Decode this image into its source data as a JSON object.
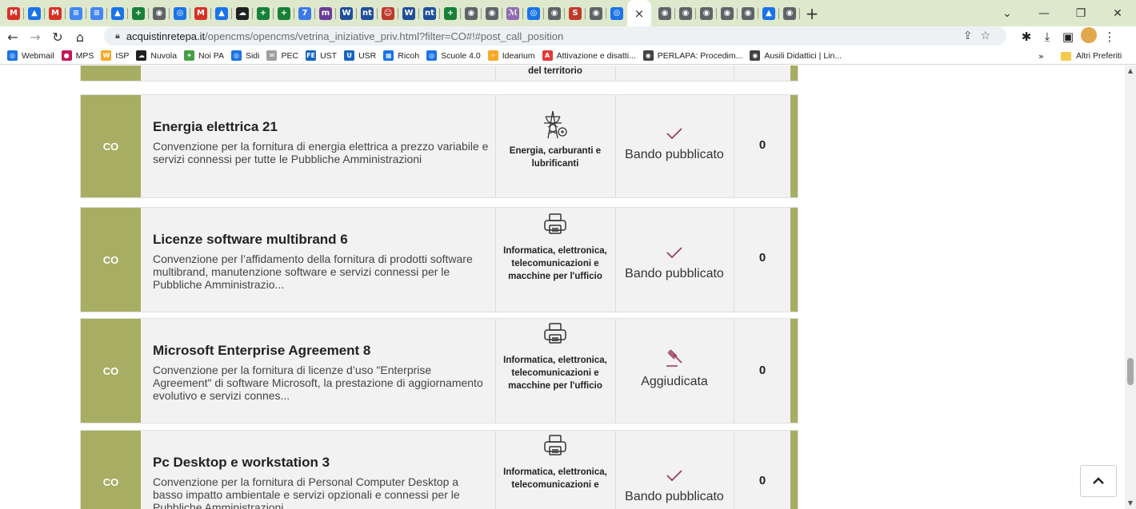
{
  "browser": {
    "close_tab_glyph": "×",
    "new_tab_glyph": "+",
    "window_controls": [
      "⌄",
      "—",
      "❐",
      "✕"
    ],
    "address": {
      "domain": "acquistinretepa.it",
      "path": "/opencms/opencms/vetrina_iniziative_priv.html?filter=CO#!#post_call_position"
    },
    "tab_icons": [
      {
        "glyph": "M",
        "color": "#d93025",
        "name": "gmail-tab"
      },
      {
        "glyph": "▲",
        "color": "#1a73e8",
        "name": "drive-tab"
      },
      {
        "glyph": "M",
        "color": "#d93025",
        "name": "gmail-tab"
      },
      {
        "glyph": "≡",
        "color": "#4285f4",
        "name": "docs-tab"
      },
      {
        "glyph": "≡",
        "color": "#4285f4",
        "name": "docs-tab"
      },
      {
        "glyph": "▲",
        "color": "#1a73e8",
        "name": "drive-tab"
      },
      {
        "glyph": "+",
        "color": "#188038",
        "name": "classroom-tab"
      },
      {
        "glyph": "◉",
        "color": "#5f6368",
        "name": "web-tab"
      },
      {
        "glyph": "◎",
        "color": "#1a73e8",
        "name": "site-tab"
      },
      {
        "glyph": "M",
        "color": "#d93025",
        "name": "gmail-tab"
      },
      {
        "glyph": "▲",
        "color": "#1a73e8",
        "name": "drive-tab"
      },
      {
        "glyph": "☁",
        "color": "#202124",
        "name": "cloud-tab"
      },
      {
        "glyph": "+",
        "color": "#188038",
        "name": "classroom-tab"
      },
      {
        "glyph": "+",
        "color": "#188038",
        "name": "classroom-tab"
      },
      {
        "glyph": "7",
        "color": "#3b78e7",
        "name": "calendar-tab"
      },
      {
        "glyph": "m",
        "color": "#6a3d9a",
        "name": "site-tab"
      },
      {
        "glyph": "W",
        "color": "#1f4e9c",
        "name": "wordpress-tab"
      },
      {
        "glyph": "nt",
        "color": "#1f4e9c",
        "name": "site-tab"
      },
      {
        "glyph": "☺",
        "color": "#c0392b",
        "name": "site-tab"
      },
      {
        "glyph": "W",
        "color": "#1f4e9c",
        "name": "wordpress-tab"
      },
      {
        "glyph": "nt",
        "color": "#1f4e9c",
        "name": "site-tab"
      },
      {
        "glyph": "+",
        "color": "#188038",
        "name": "classroom-tab"
      },
      {
        "glyph": "◉",
        "color": "#5f6368",
        "name": "web-tab"
      },
      {
        "glyph": "◉",
        "color": "#5f6368",
        "name": "web-tab"
      },
      {
        "glyph": "ℳ",
        "color": "#8e6ab0",
        "name": "site-tab"
      },
      {
        "glyph": "◎",
        "color": "#1a73e8",
        "name": "site-tab"
      },
      {
        "glyph": "◉",
        "color": "#5f6368",
        "name": "web-tab"
      },
      {
        "glyph": "S",
        "color": "#c0392b",
        "name": "site-tab"
      },
      {
        "glyph": "◉",
        "color": "#5f6368",
        "name": "web-tab"
      },
      {
        "glyph": "◎",
        "color": "#1a73e8",
        "name": "site-tab"
      }
    ],
    "tab_icons_after": [
      {
        "glyph": "◉",
        "color": "#5f6368",
        "name": "web-tab"
      },
      {
        "glyph": "◉",
        "color": "#5f6368",
        "name": "web-tab"
      },
      {
        "glyph": "◉",
        "color": "#5f6368",
        "name": "web-tab"
      },
      {
        "glyph": "◉",
        "color": "#5f6368",
        "name": "web-tab"
      },
      {
        "glyph": "◉",
        "color": "#5f6368",
        "name": "web-tab"
      },
      {
        "glyph": "▲",
        "color": "#1a73e8",
        "name": "site-tab"
      },
      {
        "glyph": "◉",
        "color": "#5f6368",
        "name": "web-tab"
      }
    ],
    "bookmarks": [
      {
        "label": "Webmail",
        "color": "#1a73e8",
        "glyph": "◎"
      },
      {
        "label": "MPS",
        "color": "#c2185b",
        "glyph": "●"
      },
      {
        "label": "ISP",
        "color": "#f9a825",
        "glyph": "W"
      },
      {
        "label": "Nuvola",
        "color": "#202124",
        "glyph": "☁"
      },
      {
        "label": "Noi PA",
        "color": "#43a047",
        "glyph": "✦"
      },
      {
        "label": "Sidi",
        "color": "#1a73e8",
        "glyph": "◎"
      },
      {
        "label": "PEC",
        "color": "#9e9e9e",
        "glyph": "✉"
      },
      {
        "label": "UST",
        "color": "#1565c0",
        "glyph": "FE"
      },
      {
        "label": "USR",
        "color": "#1565c0",
        "glyph": "U"
      },
      {
        "label": "Ricoh",
        "color": "#1a73e8",
        "glyph": "▦"
      },
      {
        "label": "Scuole 4.0",
        "color": "#1a73e8",
        "glyph": "◎"
      },
      {
        "label": "Idearium",
        "color": "#f9a825",
        "glyph": "✧"
      },
      {
        "label": "Attivazione e disatti...",
        "color": "#e53935",
        "glyph": "A"
      },
      {
        "label": "PERLAPA: Procedim...",
        "color": "#424242",
        "glyph": "◉"
      },
      {
        "label": "Ausili Didattici | Lin...",
        "color": "#424242",
        "glyph": "◉"
      }
    ],
    "bookmarks_more": "»",
    "other_bookmarks": "Altri Preferiti"
  },
  "rows": [
    {
      "code": "CO",
      "title": "",
      "desc": "",
      "category": "del territorio",
      "status": "",
      "count": "",
      "partial": true
    },
    {
      "code": "CO",
      "title": "Energia elettrica 21",
      "desc": "Convenzione per la fornitura di energia elettrica a prezzo variabile e servizi connessi per tutte le Pubbliche Amministrazioni",
      "category": "Energia, carburanti e lubrificanti",
      "category_icon": "energy-pylon-icon",
      "status": "Bando pubblicato",
      "status_icon": "checkmark-icon",
      "count": "0"
    },
    {
      "code": "CO",
      "title": "Licenze software multibrand 6",
      "desc": "Convenzione per l’affidamento della fornitura di prodotti software multibrand, manutenzione software e servizi connessi per le Pubbliche Amministrazio...",
      "category": "Informatica, elettronica, telecomunicazioni e macchine per l'ufficio",
      "category_icon": "printer-icon",
      "status": "Bando pubblicato",
      "status_icon": "checkmark-icon",
      "count": "0"
    },
    {
      "code": "CO",
      "title": "Microsoft Enterprise Agreement 8",
      "desc": "Convenzione per la fornitura di licenze d’uso \"Enterprise Agreement\" di software Microsoft, la prestazione di aggiornamento evolutivo e servizi connes...",
      "category": "Informatica, elettronica, telecomunicazioni e macchine per l'ufficio",
      "category_icon": "printer-icon",
      "status": "Aggiudicata",
      "status_icon": "gavel-icon",
      "count": "0"
    },
    {
      "code": "CO",
      "title": "Pc Desktop e workstation 3",
      "desc": "Convenzione per la fornitura di Personal Computer Desktop a basso impatto ambientale e servizi opzionali e connessi per le Pubbliche Amministrazioni",
      "category": "Informatica, elettronica, telecomunicazioni e",
      "category_icon": "printer-icon",
      "status": "Bando pubblicato",
      "status_icon": "checkmark-icon",
      "count": "0"
    }
  ],
  "scroll_top_glyph": "⌃",
  "colors": {
    "accent_olive": "#a7ae63",
    "status_icon": "#9c3d5e",
    "tabstrip": "#dee8cc"
  }
}
